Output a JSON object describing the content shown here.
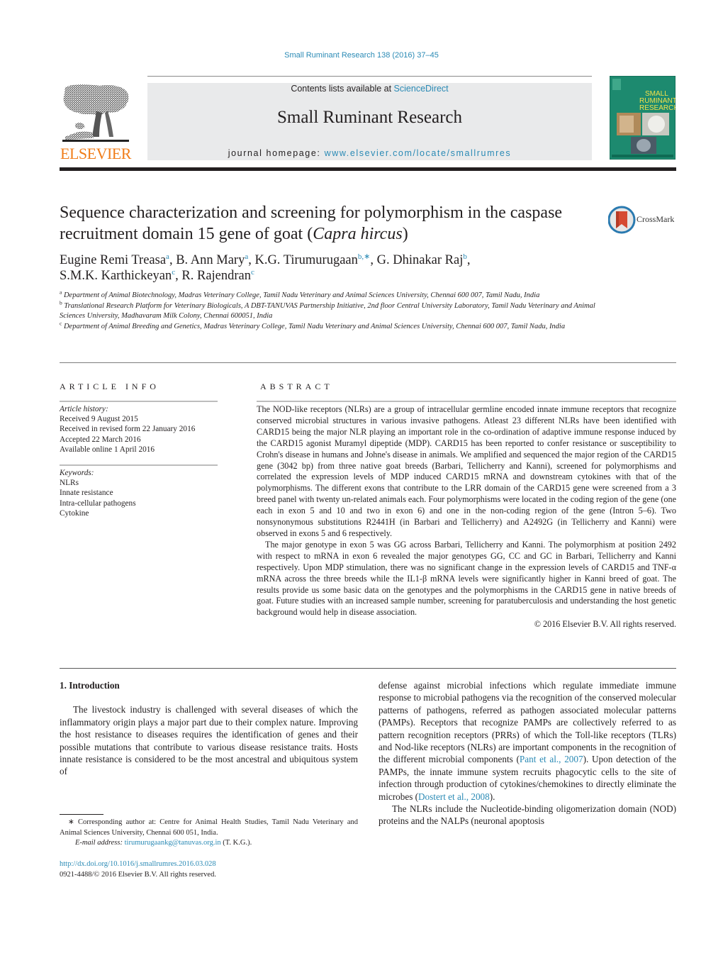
{
  "header": {
    "journal_reference": "Small Ruminant Research 138 (2016) 37–45",
    "publisher_logo_text": "ELSEVIER",
    "contents_prefix": "Contents lists available at ",
    "contents_link": "ScienceDirect",
    "journal_title": "Small Ruminant Research",
    "homepage_prefix": "journal homepage: ",
    "homepage_link": "www.elsevier.com/locate/smallrumres",
    "cover_title_lines": [
      "SMALL",
      "RUMINANT",
      "RESEARCH"
    ]
  },
  "article": {
    "title_part1": "Sequence characterization and screening for polymorphism in the caspase recruitment domain 15 gene of goat (",
    "title_italic": "Capra hircus",
    "title_part2": ")",
    "crossmark_label": "CrossMark",
    "authors": [
      {
        "name": "Eugine Remi Treasa",
        "aff": "a",
        "sep": ", "
      },
      {
        "name": "B. Ann Mary",
        "aff": "a",
        "sep": ", "
      },
      {
        "name": "K.G. Tirumurugaan",
        "aff": "b,∗",
        "sep": ", "
      },
      {
        "name": "G. Dhinakar Raj",
        "aff": "b",
        "sep": ","
      },
      {
        "name": "S.M.K. Karthickeyan",
        "aff": "c",
        "sep": ", "
      },
      {
        "name": "R. Rajendran",
        "aff": "c",
        "sep": ""
      }
    ],
    "affiliations": [
      {
        "label": "a",
        "text": "Department of Animal Biotechnology, Madras Veterinary College, Tamil Nadu Veterinary and Animal Sciences University, Chennai 600 007, Tamil Nadu, India"
      },
      {
        "label": "b",
        "text": "Translational Research Platform for Veterinary Biologicals, A DBT-TANUVAS Partnership Initiative, 2nd floor Central University Laboratory, Tamil Nadu Veterinary and Animal Sciences University, Madhavaram Milk Colony, Chennai 600051, India"
      },
      {
        "label": "c",
        "text": "Department of Animal Breeding and Genetics, Madras Veterinary College, Tamil Nadu Veterinary and Animal Sciences University, Chennai 600 007, Tamil Nadu, India"
      }
    ]
  },
  "article_info": {
    "heading": "ARTICLE INFO",
    "history_label": "Article history:",
    "history": [
      "Received 9 August 2015",
      "Received in revised form 22 January 2016",
      "Accepted 22 March 2016",
      "Available online 1 April 2016"
    ],
    "keywords_label": "Keywords:",
    "keywords": [
      "NLRs",
      "Innate resistance",
      "Intra-cellular pathogens",
      "Cytokine"
    ]
  },
  "abstract": {
    "heading": "ABSTRACT",
    "paragraphs": [
      "The NOD-like receptors (NLRs) are a group of intracellular germline encoded innate immune receptors that recognize conserved microbial structures in various invasive pathogens. Atleast 23 different NLRs have been identified with CARD15 being the major NLR playing an important role in the co-ordination of adaptive immune response induced by the CARD15 agonist Muramyl dipeptide (MDP). CARD15 has been reported to confer resistance or susceptibility to Crohn's disease in humans and Johne's disease in animals. We amplified and sequenced the major region of the CARD15 gene (3042 bp) from three native goat breeds (Barbari, Tellicherry and Kanni), screened for polymorphisms and correlated the expression levels of MDP induced CARD15 mRNA and downstream cytokines with that of the polymorphisms. The different exons that contribute to the LRR domain of the CARD15 gene were screened from a 3 breed panel with twenty un-related animals each. Four polymorphisms were located in the coding region of the gene (one each in exon 5 and 10 and two in exon 6) and one in the non-coding region of the gene (Intron 5–6). Two nonsynonymous substitutions R2441H (in Barbari and Tellicherry) and A2492G (in Tellicherry and Kanni) were observed in exons 5 and 6 respectively.",
      "The major genotype in exon 5 was GG across Barbari, Tellicherry and Kanni. The polymorphism at position 2492 with respect to mRNA in exon 6 revealed the major genotypes GG, CC and GC in Barbari, Tellicherry and Kanni respectively. Upon MDP stimulation, there was no significant change in the expression levels of CARD15 and TNF-α mRNA across the three breeds while the IL1-β mRNA levels were significantly higher in Kanni breed of goat. The results provide us some basic data on the genotypes and the polymorphisms in the CARD15 gene in native breeds of goat. Future studies with an increased sample number, screening for paratuberculosis and understanding the host genetic background would help in disease association."
    ],
    "copyright": "© 2016 Elsevier B.V. All rights reserved."
  },
  "body": {
    "section_heading": "1.  Introduction",
    "left_paragraph": "The livestock industry is challenged with several diseases of which the inflammatory origin plays a major part due to their complex nature. Improving the host resistance to diseases requires the identification of genes and their possible mutations that contribute to various disease resistance traits. Hosts innate resistance is considered to be the most ancestral and ubiquitous system of",
    "right_p1_a": "defense against microbial infections which regulate immediate immune response to microbial pathogens via the recognition of the conserved molecular patterns of pathogens, referred as pathogen associated molecular patterns (PAMPs). Receptors that recognize PAMPs are collectively referred to as pattern recognition receptors (PRRs) of which the Toll-like receptors (TLRs) and Nod-like receptors (NLRs) are important components in the recognition of the different microbial components (",
    "right_ref1": "Pant et al., 2007",
    "right_p1_b": "). Upon detection of the PAMPs, the innate immune system recruits phagocytic cells to the site of infection through production of cytokines/chemokines to directly eliminate the microbes (",
    "right_ref2": "Dostert et al., 2008",
    "right_p1_c": ").",
    "right_p2": "The NLRs include the Nucleotide-binding oligomerization domain (NOD) proteins and the NALPs (neuronal apoptosis"
  },
  "footnotes": {
    "corresponding_marker": "∗",
    "corresponding_text": "Corresponding author at: Centre for Animal Health Studies, Tamil Nadu Veterinary and Animal Sciences University, Chennai 600 051, India.",
    "email_label": "E-mail address: ",
    "email": "tirumurugaankg@tanuvas.org.in",
    "email_suffix": " (T. K.G.).",
    "doi": "http://dx.doi.org/10.1016/j.smallrumres.2016.03.028",
    "issn_line": "0921-4488/© 2016 Elsevier B.V. All rights reserved."
  },
  "colors": {
    "link": "#2a8ab5",
    "elsevier_orange": "#f07d1a",
    "masthead_bg": "#e9eaeb",
    "cover_green": "#1d8a6f",
    "crossmark_red": "#d64a32"
  }
}
